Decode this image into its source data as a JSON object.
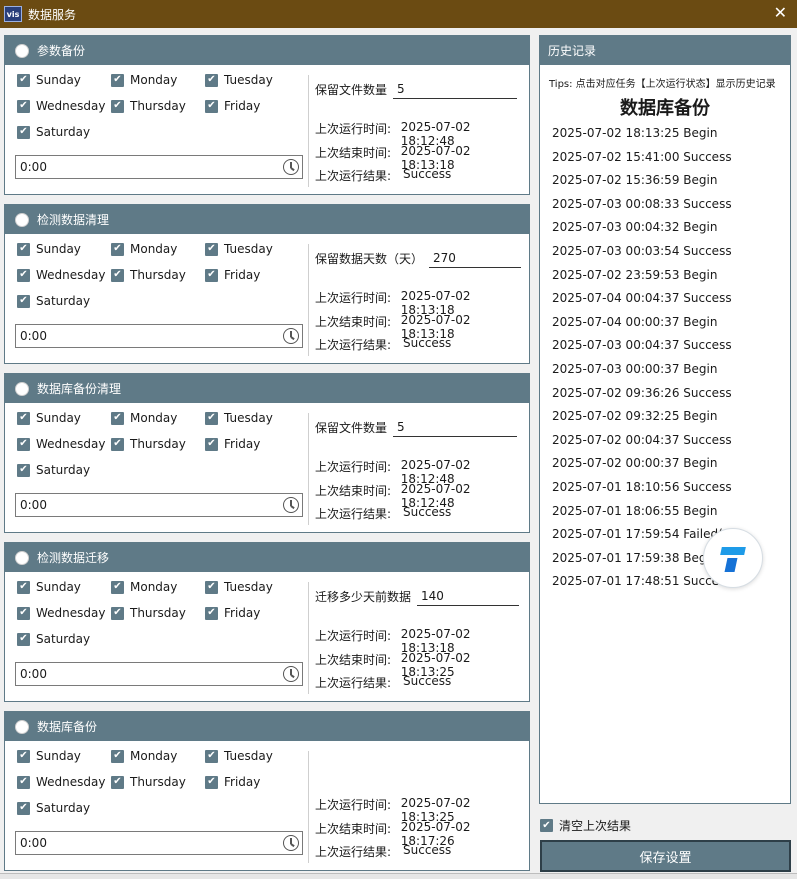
{
  "window": {
    "app_icon": "vis",
    "title": "数据服务",
    "close": "✕"
  },
  "days": [
    "Sunday",
    "Monday",
    "Tuesday",
    "Wednesday",
    "Thursday",
    "Friday",
    "Saturday"
  ],
  "groups": [
    {
      "title": "参数备份",
      "time": "0:00",
      "field_label": "保留文件数量",
      "field_value": "5",
      "last_run_label": "上次运行时间:",
      "last_run": "2025-07-02 18:12:48",
      "last_end_label": "上次结束时间:",
      "last_end": "2025-07-02 18:13:18",
      "last_result_label": "上次运行结果:",
      "last_result": "Success"
    },
    {
      "title": "检测数据清理",
      "time": "0:00",
      "field_label": "保留数据天数（天）",
      "field_value": "270",
      "last_run_label": "上次运行时间:",
      "last_run": "2025-07-02 18:13:18",
      "last_end_label": "上次结束时间:",
      "last_end": "2025-07-02 18:13:18",
      "last_result_label": "上次运行结果:",
      "last_result": "Success"
    },
    {
      "title": "数据库备份清理",
      "time": "0:00",
      "field_label": "保留文件数量",
      "field_value": "5",
      "last_run_label": "上次运行时间:",
      "last_run": "2025-07-02 18:12:48",
      "last_end_label": "上次结束时间:",
      "last_end": "2025-07-02 18:12:48",
      "last_result_label": "上次运行结果:",
      "last_result": "Success"
    },
    {
      "title": "检测数据迁移",
      "time": "0:00",
      "field_label": "迁移多少天前数据",
      "field_value": "140",
      "last_run_label": "上次运行时间:",
      "last_run": "2025-07-02 18:13:18",
      "last_end_label": "上次结束时间:",
      "last_end": "2025-07-02 18:13:25",
      "last_result_label": "上次运行结果:",
      "last_result": "Success"
    },
    {
      "title": "数据库备份",
      "time": "0:00",
      "last_run_label": "上次运行时间:",
      "last_run": "2025-07-02 18:13:25",
      "last_end_label": "上次结束时间:",
      "last_end": "2025-07-02 18:17:26",
      "last_result_label": "上次运行结果:",
      "last_result": "Success"
    }
  ],
  "history": {
    "header": "历史记录",
    "tips": "Tips:  点击对应任务【上次运行状态】显示历史记录",
    "title": "数据库备份",
    "items": [
      "2025-07-02 18:13:25 Begin",
      "2025-07-02 15:41:00 Success",
      "2025-07-02 15:36:59 Begin",
      "2025-07-03 00:08:33 Success",
      "2025-07-03 00:04:32 Begin",
      "2025-07-03 00:03:54 Success",
      "2025-07-02 23:59:53 Begin",
      "2025-07-04 00:04:37 Success",
      "2025-07-04 00:00:37 Begin",
      "2025-07-03 00:04:37 Success",
      "2025-07-03 00:00:37 Begin",
      "2025-07-02 09:36:26 Success",
      "2025-07-02 09:32:25 Begin",
      "2025-07-02 00:04:37 Success",
      "2025-07-02 00:00:37 Begin",
      "2025-07-01 18:10:56 Success",
      "2025-07-01 18:06:55 Begin",
      "2025-07-01 17:59:54 Failed(-1",
      "2025-07-01 17:59:38 Begin",
      "2025-07-01 17:48:51 Success"
    ]
  },
  "clear_label": "清空上次结果",
  "save_label": "保存设置",
  "icons": {
    "check": "✔",
    "close": "close-icon",
    "clock": "clock-icon",
    "radio": "radio-icon",
    "badge": "floating-assistant-icon"
  },
  "colors": {
    "titlebar": "#6b4b12",
    "accent": "#5f7a87"
  }
}
